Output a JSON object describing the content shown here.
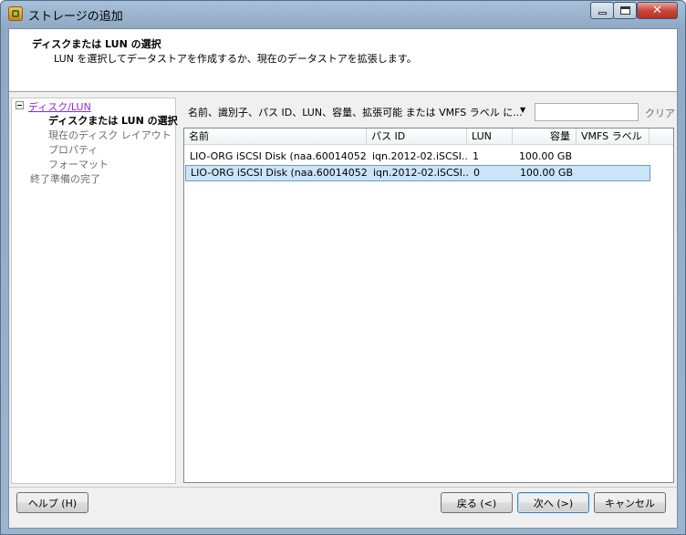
{
  "window": {
    "title": "ストレージの追加"
  },
  "header": {
    "title": "ディスクまたは LUN の選択",
    "subtitle": "LUN を選択してデータストアを作成するか、現在のデータストアを拡張します。"
  },
  "nav": {
    "group_label": "ディスク/LUN",
    "items": [
      {
        "label": "ディスクまたは LUN の選択"
      },
      {
        "label": "現在のディスク レイアウト"
      },
      {
        "label": "プロパティ"
      },
      {
        "label": "フォーマット"
      }
    ],
    "final_label": "終了準備の完了"
  },
  "filter": {
    "label": "名前、識別子、パス ID、LUN、容量、拡張可能 または VMFS ラベル に...",
    "value": "",
    "clear_label": "クリア"
  },
  "table": {
    "columns": [
      "名前",
      "パス ID",
      "LUN",
      "容量",
      "VMFS ラベル"
    ],
    "rows": [
      {
        "name": "LIO-ORG iSCSI Disk (naa.60014052...",
        "path_id": "iqn.2012-02.iSCSI...",
        "lun": "1",
        "capacity": "100.00 GB",
        "vmfs_label": ""
      },
      {
        "name": "LIO-ORG iSCSI Disk (naa.60014052...",
        "path_id": "iqn.2012-02.iSCSI...",
        "lun": "0",
        "capacity": "100.00 GB",
        "vmfs_label": ""
      }
    ]
  },
  "buttons": {
    "help": "ヘルプ (H)",
    "back": "戻る (<)",
    "next": "次へ (>)",
    "cancel": "キャンセル"
  }
}
